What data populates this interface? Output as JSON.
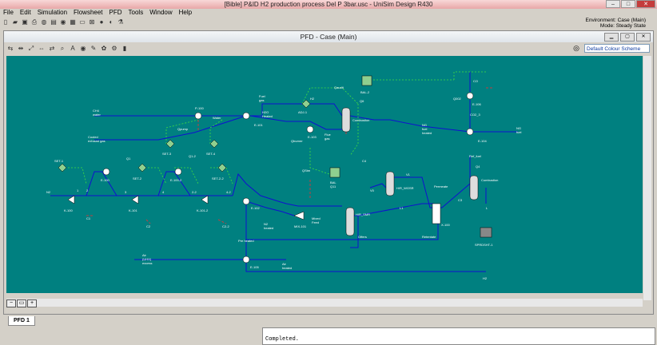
{
  "app": {
    "title": "[Bible] P&ID H2 production process Del P 3bar.usc - UniSim Design R430",
    "window_buttons": [
      "–",
      "□",
      "✕"
    ]
  },
  "menu": [
    "File",
    "Edit",
    "Simulation",
    "Flowsheet",
    "PFD",
    "Tools",
    "Window",
    "Help"
  ],
  "environment": {
    "line1": "Environment: Case (Main)",
    "line2": "Mode: Steady State"
  },
  "pfd": {
    "title": "PFD - Case (Main)",
    "colour_scheme": "Default Colour Scheme",
    "tab": "PFD 1"
  },
  "trace": {
    "message": "Completed."
  },
  "colors": {
    "canvas": "#008080",
    "stream": "#1010d0",
    "energy": "#c04040",
    "logic": "#40e040"
  },
  "diagram": {
    "labels": [
      {
        "id": "set1",
        "text": "SET-1"
      },
      {
        "id": "k100",
        "text": "K-100"
      },
      {
        "id": "n2",
        "text": "N2"
      },
      {
        "id": "s1",
        "text": "1"
      },
      {
        "id": "s2",
        "text": "2"
      },
      {
        "id": "c1",
        "text": "C1"
      },
      {
        "id": "e100",
        "text": "E-100"
      },
      {
        "id": "q1",
        "text": "Q1"
      },
      {
        "id": "s3",
        "text": "3"
      },
      {
        "id": "set2",
        "text": "SET-2"
      },
      {
        "id": "k101",
        "text": "K-101"
      },
      {
        "id": "s4",
        "text": "4"
      },
      {
        "id": "c2",
        "text": "C2"
      },
      {
        "id": "e1002",
        "text": "E-100-2"
      },
      {
        "id": "set3",
        "text": "SET-3"
      },
      {
        "id": "q12",
        "text": "Q1-2"
      },
      {
        "id": "s22",
        "text": "2-2"
      },
      {
        "id": "k1012",
        "text": "K-101-2"
      },
      {
        "id": "c22",
        "text": "C2-2"
      },
      {
        "id": "set4",
        "text": "SET-4"
      },
      {
        "id": "set22",
        "text": "SET-2-2"
      },
      {
        "id": "s42",
        "text": "4-2"
      },
      {
        "id": "ch4",
        "text": "CH4"
      },
      {
        "id": "water",
        "text": "water"
      },
      {
        "id": "p100",
        "text": "P-100"
      },
      {
        "id": "qpump",
        "text": "Qpump"
      },
      {
        "id": "waterstr",
        "text": "Water"
      },
      {
        "id": "cooled",
        "text": "Cooled"
      },
      {
        "id": "exhaust",
        "text": "exhaust gas"
      },
      {
        "id": "e101",
        "text": "E-101"
      },
      {
        "id": "fuel",
        "text": "Fuel"
      },
      {
        "id": "gas",
        "text": "gas"
      },
      {
        "id": "adj1",
        "text": "ADJ-1"
      },
      {
        "id": "h2o",
        "text": "H2O"
      },
      {
        "id": "heated",
        "text": "Heated"
      },
      {
        "id": "qburner",
        "text": "Qburner"
      },
      {
        "id": "e103",
        "text": "E-103"
      },
      {
        "id": "fluegas",
        "text": "Flue"
      },
      {
        "id": "fluegas2",
        "text": "gas"
      },
      {
        "id": "qaudit",
        "text": "Qaudit"
      },
      {
        "id": "bal2",
        "text": "BAL-2"
      },
      {
        "id": "q6",
        "text": "Q6"
      },
      {
        "id": "combustion",
        "text": "Combustion"
      },
      {
        "id": "h2comb",
        "text": "H2"
      },
      {
        "id": "qstm",
        "text": "QStm"
      },
      {
        "id": "bal",
        "text": "BAL"
      },
      {
        "id": "q11",
        "text": "Q11"
      },
      {
        "id": "c4",
        "text": "C4"
      },
      {
        "id": "co",
        "text": "CO"
      },
      {
        "id": "qco2",
        "text": "Q002"
      },
      {
        "id": "e106",
        "text": "E-106"
      },
      {
        "id": "co2",
        "text": "CO2_3"
      },
      {
        "id": "ngfuel",
        "text": "NG"
      },
      {
        "id": "ngfuel2",
        "text": "fuel"
      },
      {
        "id": "ngfuel3",
        "text": "heated"
      },
      {
        "id": "e104",
        "text": "E-104"
      },
      {
        "id": "ng",
        "text": "NG"
      },
      {
        "id": "fuelout",
        "text": "fuel"
      },
      {
        "id": "ratfuel",
        "text": "Ref_fuel"
      },
      {
        "id": "q4",
        "text": "Q4"
      },
      {
        "id": "combustion2",
        "text": "Combustion"
      },
      {
        "id": "c3",
        "text": "C3"
      },
      {
        "id": "l",
        "text": "L"
      },
      {
        "id": "v0",
        "text": "V0"
      },
      {
        "id": "wgsr",
        "text": "H/R_WGSR"
      },
      {
        "id": "v1",
        "text": "V1"
      },
      {
        "id": "l1",
        "text": "L1"
      },
      {
        "id": "permeate",
        "text": "Permeate"
      },
      {
        "id": "x100",
        "text": "X-100"
      },
      {
        "id": "retentate",
        "text": "Retentate"
      },
      {
        "id": "smr",
        "text": "H/R_SMR"
      },
      {
        "id": "offers",
        "text": "Offers"
      },
      {
        "id": "mixed",
        "text": "Mixed"
      },
      {
        "id": "feed",
        "text": "Feed"
      },
      {
        "id": "mix101",
        "text": "MIX-101"
      },
      {
        "id": "e102",
        "text": "E-102"
      },
      {
        "id": "n2heated",
        "text": "N2"
      },
      {
        "id": "n2heated2",
        "text": "heated"
      },
      {
        "id": "preheated",
        "text": "Pre heated"
      },
      {
        "id": "spread",
        "text": "SPRDSHT-1"
      },
      {
        "id": "air",
        "text": "Air"
      },
      {
        "id": "air2",
        "text": "(UHX)"
      },
      {
        "id": "air3",
        "text": "excess"
      },
      {
        "id": "e105",
        "text": "E-105"
      },
      {
        "id": "airheated",
        "text": "Air"
      },
      {
        "id": "airheated2",
        "text": "heated"
      },
      {
        "id": "h2out",
        "text": "H2"
      }
    ]
  }
}
